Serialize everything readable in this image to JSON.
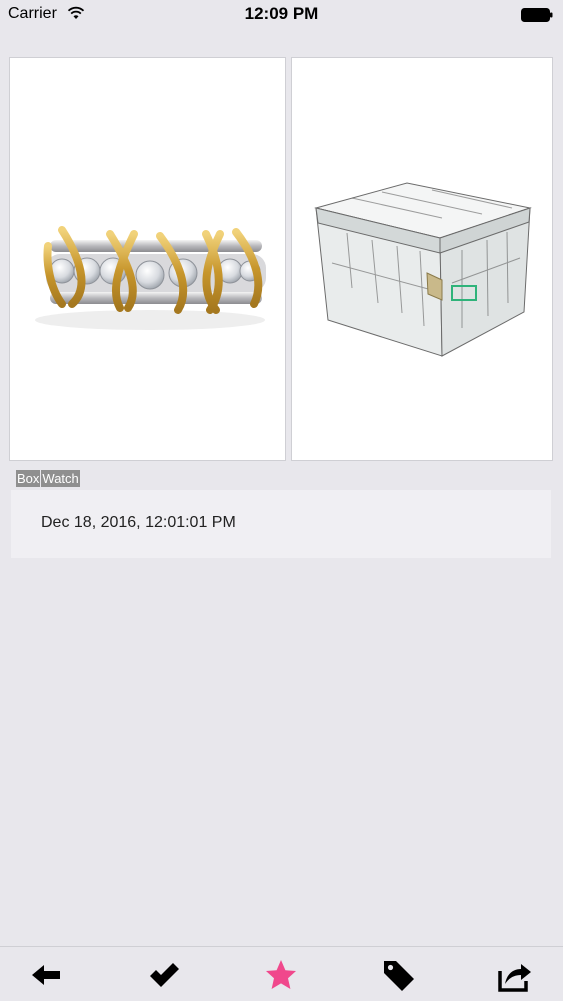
{
  "status_bar": {
    "carrier": "Carrier",
    "time": "12:09 PM"
  },
  "products": [
    {
      "name": "ring-image",
      "icon": "diamond-ring"
    },
    {
      "name": "box-image",
      "icon": "paris-print-storage-box"
    }
  ],
  "tags": [
    "Box",
    "Watch"
  ],
  "detail": {
    "date": "Dec 18, 2016, 12:01:01 PM"
  },
  "toolbar": {
    "icons": [
      "back-arrow-icon",
      "checkmark-icon",
      "star-icon",
      "tag-icon",
      "share-icon"
    ]
  },
  "colors": {
    "background": "#e8e7ec",
    "accent": "#f0488c",
    "tag_bg": "#8f8f8f"
  }
}
